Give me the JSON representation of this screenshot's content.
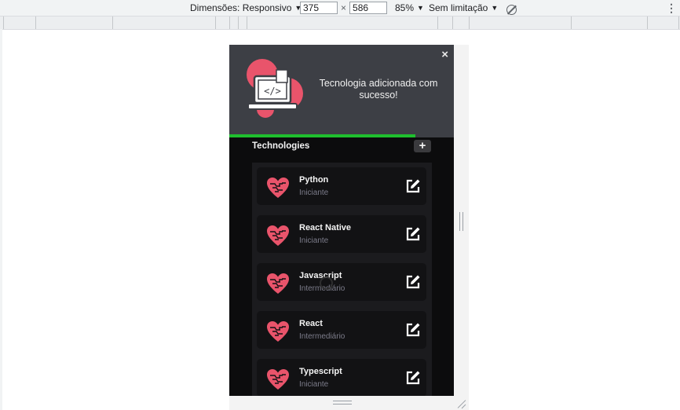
{
  "devtools": {
    "dimensions_label": "Dimensões: Responsivo",
    "width_value": "375",
    "height_value": "586",
    "times_symbol": "×",
    "zoom_label": "85%",
    "throttle_label": "Sem limitação",
    "caret": "▼",
    "menu": "⋮"
  },
  "toast": {
    "message": "Tecnologia adicionada com sucesso!",
    "close": "×",
    "progress_fraction": 0.83
  },
  "header": {
    "title": "Technologies",
    "add": "+"
  },
  "technologies": [
    {
      "name": "Python",
      "level": "Iniciante"
    },
    {
      "name": "React Native",
      "level": "Iniciante"
    },
    {
      "name": "Javascript",
      "level": "Intermediário"
    },
    {
      "name": "React",
      "level": "Intermediário"
    },
    {
      "name": "Typescript",
      "level": "Iniciante"
    }
  ],
  "colors": {
    "toast_bg": "#3d3f45",
    "progress": "#1fbf2e",
    "heart": "#e9546b",
    "page_bg": "#0c0c0d",
    "card_bg": "#121214",
    "muted_text": "#7c7c8a"
  },
  "icons": {
    "heart": "circuit-heart-icon",
    "edit": "edit-icon",
    "rotate": "rotate-disabled-icon",
    "illustration": "laptop-code-icon"
  }
}
